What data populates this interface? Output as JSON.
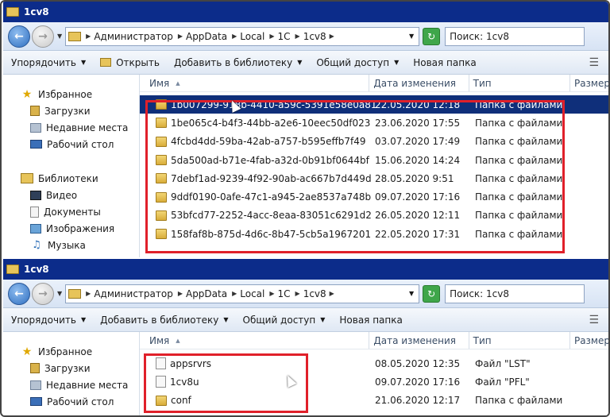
{
  "windows": [
    {
      "title": "1cv8",
      "breadcrumbs": [
        "Администратор",
        "AppData",
        "Local",
        "1C",
        "1cv8"
      ],
      "search_placeholder": "Поиск: 1cv8",
      "toolbar": {
        "organize": "Упорядочить",
        "open": "Открыть",
        "add_to_library": "Добавить в библиотеку",
        "share": "Общий доступ",
        "new_folder": "Новая папка"
      },
      "nav": {
        "favorites": "Избранное",
        "downloads": "Загрузки",
        "recent": "Недавние места",
        "desktop": "Рабочий стол",
        "libraries": "Библиотеки",
        "video": "Видео",
        "documents": "Документы",
        "images": "Изображения",
        "music": "Музыка"
      },
      "columns": {
        "name": "Имя",
        "date": "Дата изменения",
        "type": "Тип",
        "size": "Размер"
      },
      "rows": [
        {
          "name": "1b007299-918b-4410-a59c-5391e58e0a81",
          "date": "22.05.2020 12:18",
          "type": "Папка с файлами",
          "selected": true
        },
        {
          "name": "1be065c4-b4f3-44bb-a2e6-10eec50df023",
          "date": "23.06.2020 17:55",
          "type": "Папка с файлами"
        },
        {
          "name": "4fcbd4dd-59ba-42ab-a757-b595effb7f49",
          "date": "03.07.2020 17:49",
          "type": "Папка с файлами"
        },
        {
          "name": "5da500ad-b71e-4fab-a32d-0b91bf0644bf",
          "date": "15.06.2020 14:24",
          "type": "Папка с файлами"
        },
        {
          "name": "7debf1ad-9239-4f92-90ab-ac667b7d449d",
          "date": "28.05.2020 9:51",
          "type": "Папка с файлами"
        },
        {
          "name": "9ddf0190-0afe-47c1-a945-2ae8537a748b",
          "date": "09.07.2020 17:16",
          "type": "Папка с файлами"
        },
        {
          "name": "53bfcd77-2252-4acc-8eaa-83051c6291d2",
          "date": "26.05.2020 12:11",
          "type": "Папка с файлами"
        },
        {
          "name": "158faf8b-875d-4d6c-8b47-5cb5a1967201",
          "date": "22.05.2020 17:31",
          "type": "Папка с файлами"
        }
      ]
    },
    {
      "title": "1cv8",
      "breadcrumbs": [
        "Администратор",
        "AppData",
        "Local",
        "1C",
        "1cv8"
      ],
      "search_placeholder": "Поиск: 1cv8",
      "toolbar": {
        "organize": "Упорядочить",
        "add_to_library": "Добавить в библиотеку",
        "share": "Общий доступ",
        "new_folder": "Новая папка"
      },
      "nav": {
        "favorites": "Избранное",
        "downloads": "Загрузки",
        "recent": "Недавние места",
        "desktop": "Рабочий стол"
      },
      "columns": {
        "name": "Имя",
        "date": "Дата изменения",
        "type": "Тип",
        "size": "Размер"
      },
      "rows": [
        {
          "name": "appsrvrs",
          "date": "08.05.2020 12:35",
          "type": "Файл \"LST\"",
          "kind": "file"
        },
        {
          "name": "1cv8u",
          "date": "09.07.2020 17:16",
          "type": "Файл \"PFL\"",
          "kind": "file"
        },
        {
          "name": "conf",
          "date": "21.06.2020 12:17",
          "type": "Папка с файлами",
          "kind": "folder"
        }
      ]
    }
  ],
  "colors": {
    "titlebar": "#0c2c8a",
    "selection": "#0f2f7a",
    "highlight_box": "#e0202a"
  }
}
